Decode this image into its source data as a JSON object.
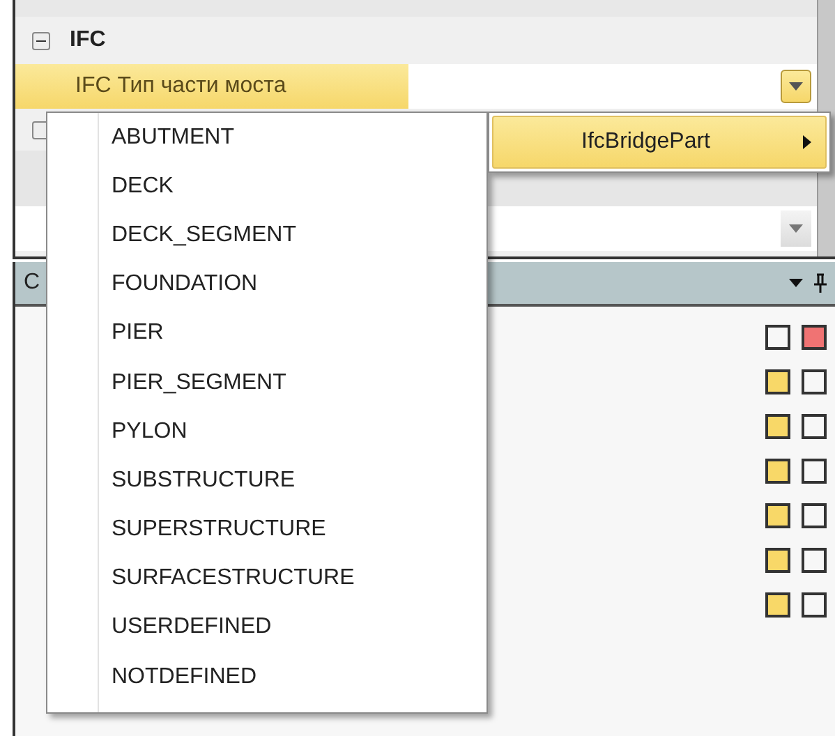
{
  "property_grid": {
    "rows": [
      {
        "kind": "category",
        "label": "IFC",
        "expanded": true
      },
      {
        "kind": "property",
        "label": "IFC Тип части моста",
        "selected": true
      },
      {
        "kind": "category_cut"
      },
      {
        "kind": "spacer"
      },
      {
        "kind": "dropdown_row"
      }
    ]
  },
  "panel": {
    "title": "C",
    "swatch_rows": [
      {
        "swatches": [
          {
            "color": "#f7f7f7"
          },
          {
            "color": "#f07373"
          }
        ]
      },
      {
        "swatches": [
          {
            "color": "#f8d868"
          },
          {
            "color": "#f7f7f7"
          }
        ]
      },
      {
        "swatches": [
          {
            "color": "#f8d868"
          },
          {
            "color": "#f7f7f7"
          }
        ]
      },
      {
        "swatches": [
          {
            "color": "#f8d868"
          },
          {
            "color": "#f7f7f7"
          }
        ]
      },
      {
        "swatches": [
          {
            "color": "#f8d868"
          },
          {
            "color": "#f7f7f7"
          }
        ]
      },
      {
        "swatches": [
          {
            "color": "#f8d868"
          },
          {
            "color": "#f7f7f7"
          }
        ]
      },
      {
        "swatches": [
          {
            "color": "#f8d868"
          },
          {
            "color": "#f7f7f7"
          }
        ]
      }
    ]
  },
  "context_menu": {
    "items": [
      {
        "label": "ABUTMENT",
        "selected": false
      },
      {
        "label": "DECK",
        "selected": false
      },
      {
        "label": "DECK_SEGMENT",
        "selected": false
      },
      {
        "label": "FOUNDATION",
        "selected": false
      },
      {
        "label": "PIER",
        "selected": false
      },
      {
        "label": "PIER_SEGMENT",
        "selected": false
      },
      {
        "label": "PYLON",
        "selected": false
      },
      {
        "label": "SUBSTRUCTURE",
        "selected": false
      },
      {
        "label": "SUPERSTRUCTURE",
        "selected": false
      },
      {
        "label": "SURFACESTRUCTURE",
        "selected": false
      },
      {
        "label": "USERDEFINED",
        "selected": false
      },
      {
        "label": "NOTDEFINED",
        "selected": false
      }
    ]
  },
  "submenu": {
    "items": [
      {
        "label": "IfcBridgePart",
        "selected": true
      }
    ]
  }
}
